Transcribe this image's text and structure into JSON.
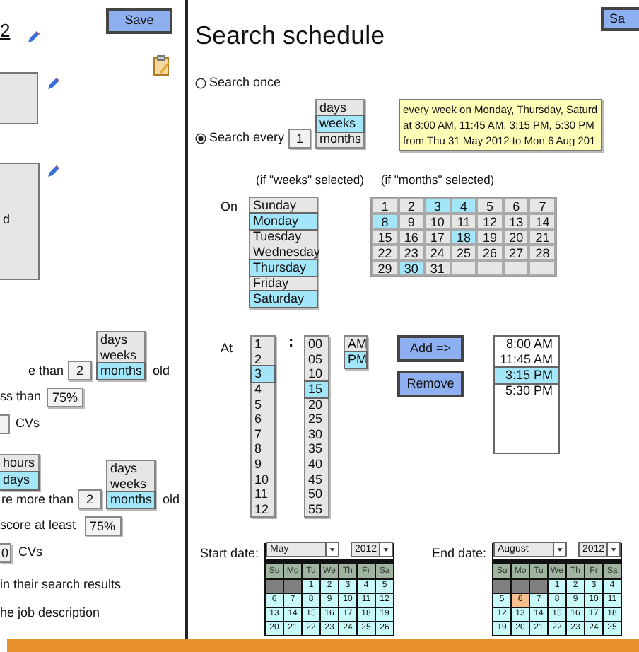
{
  "left_panel": {
    "heading_fragment": "2",
    "save_button": "Save",
    "box_fragment": "d",
    "age_filter_1": {
      "options": [
        {
          "label": "days",
          "selected": false
        },
        {
          "label": "weeks",
          "selected": false
        },
        {
          "label": "months",
          "selected": true
        }
      ],
      "prefix": "e than",
      "value": "2",
      "suffix": "old"
    },
    "score_filter_1": {
      "prefix": "ss than",
      "value": "75%"
    },
    "count_1": {
      "suffix": "CVs"
    },
    "unit_list": [
      {
        "label": "hours",
        "selected": false
      },
      {
        "label": "days",
        "selected": true
      }
    ],
    "age_filter_2": {
      "options": [
        {
          "label": "days",
          "selected": false
        },
        {
          "label": "weeks",
          "selected": false
        },
        {
          "label": "months",
          "selected": true
        }
      ],
      "prefix": "re more than",
      "value": "2",
      "suffix": "old"
    },
    "score_filter_2": {
      "prefix": "score at least",
      "value": "75%"
    },
    "count_2": {
      "value": "0",
      "suffix": "CVs"
    },
    "notes": [
      "in their search results",
      "he job description"
    ]
  },
  "right_panel": {
    "title": "Search schedule",
    "save_button": "Sa",
    "modes": [
      {
        "label": "Search once",
        "selected": false
      },
      {
        "label": "Search every",
        "selected": true
      }
    ],
    "interval": {
      "value": "1",
      "units": [
        {
          "label": "days",
          "selected": false
        },
        {
          "label": "weeks",
          "selected": true
        },
        {
          "label": "months",
          "selected": false
        }
      ]
    },
    "summary": [
      "every week on Monday, Thursday, Saturd",
      "at 8:00 AM, 11:45 AM, 3:15 PM, 5:30 PM",
      "from Thu 31 May 2012 to Mon 6 Aug 201"
    ],
    "weeks_caption": "(if \"weeks\" selected)",
    "months_caption": "(if \"months\" selected)",
    "on_label": "On",
    "weekdays": [
      {
        "label": "Sunday",
        "selected": false
      },
      {
        "label": "Monday",
        "selected": true
      },
      {
        "label": "Tuesday",
        "selected": false
      },
      {
        "label": "Wednesday",
        "selected": false
      },
      {
        "label": "Thursday",
        "selected": true
      },
      {
        "label": "Friday",
        "selected": false
      },
      {
        "label": "Saturday",
        "selected": true
      }
    ],
    "month_days": [
      {
        "label": "1",
        "selected": false
      },
      {
        "label": "2",
        "selected": false
      },
      {
        "label": "3",
        "selected": true
      },
      {
        "label": "4",
        "selected": true
      },
      {
        "label": "5",
        "selected": false
      },
      {
        "label": "6",
        "selected": false
      },
      {
        "label": "7",
        "selected": false
      },
      {
        "label": "8",
        "selected": true
      },
      {
        "label": "9",
        "selected": false
      },
      {
        "label": "10",
        "selected": false
      },
      {
        "label": "11",
        "selected": false
      },
      {
        "label": "12",
        "selected": false
      },
      {
        "label": "13",
        "selected": false
      },
      {
        "label": "14",
        "selected": false
      },
      {
        "label": "15",
        "selected": false
      },
      {
        "label": "16",
        "selected": false
      },
      {
        "label": "17",
        "selected": false
      },
      {
        "label": "18",
        "selected": true
      },
      {
        "label": "19",
        "selected": false
      },
      {
        "label": "20",
        "selected": false
      },
      {
        "label": "21",
        "selected": false
      },
      {
        "label": "22",
        "selected": false
      },
      {
        "label": "23",
        "selected": false
      },
      {
        "label": "24",
        "selected": false
      },
      {
        "label": "25",
        "selected": false
      },
      {
        "label": "26",
        "selected": false
      },
      {
        "label": "27",
        "selected": false
      },
      {
        "label": "28",
        "selected": false
      },
      {
        "label": "29",
        "selected": false
      },
      {
        "label": "30",
        "selected": true
      },
      {
        "label": "31",
        "selected": false
      }
    ],
    "at_label": "At",
    "hours": [
      {
        "label": "1",
        "selected": false
      },
      {
        "label": "2",
        "selected": false
      },
      {
        "label": "3",
        "selected": true
      },
      {
        "label": "4",
        "selected": false
      },
      {
        "label": "5",
        "selected": false
      },
      {
        "label": "6",
        "selected": false
      },
      {
        "label": "7",
        "selected": false
      },
      {
        "label": "8",
        "selected": false
      },
      {
        "label": "9",
        "selected": false
      },
      {
        "label": "10",
        "selected": false
      },
      {
        "label": "11",
        "selected": false
      },
      {
        "label": "12",
        "selected": false
      }
    ],
    "separator": ":",
    "minutes": [
      {
        "label": "00",
        "selected": false
      },
      {
        "label": "05",
        "selected": false
      },
      {
        "label": "10",
        "selected": false
      },
      {
        "label": "15",
        "selected": true
      },
      {
        "label": "20",
        "selected": false
      },
      {
        "label": "25",
        "selected": false
      },
      {
        "label": "30",
        "selected": false
      },
      {
        "label": "35",
        "selected": false
      },
      {
        "label": "40",
        "selected": false
      },
      {
        "label": "45",
        "selected": false
      },
      {
        "label": "50",
        "selected": false
      },
      {
        "label": "55",
        "selected": false
      }
    ],
    "meridiem": [
      {
        "label": "AM",
        "selected": false
      },
      {
        "label": "PM",
        "selected": true
      }
    ],
    "add_button": "Add =>",
    "remove_button": "Remove",
    "times": [
      {
        "label": "8:00 AM",
        "selected": false
      },
      {
        "label": "11:45 AM",
        "selected": false
      },
      {
        "label": "3:15 PM",
        "selected": true
      },
      {
        "label": "5:30 PM",
        "selected": false
      }
    ],
    "dates": [
      {
        "label": "Start date:",
        "month": "May",
        "year": "2012",
        "weekdays": [
          "Su",
          "Mo",
          "Tu",
          "We",
          "Th",
          "Fr",
          "Sa"
        ],
        "days": [
          {
            "kind": "blank"
          },
          {
            "kind": "blank"
          },
          {
            "kind": "day",
            "label": "1",
            "selected": false
          },
          {
            "kind": "day",
            "label": "2",
            "selected": false
          },
          {
            "kind": "day",
            "label": "3",
            "selected": false
          },
          {
            "kind": "day",
            "label": "4",
            "selected": false
          },
          {
            "kind": "day",
            "label": "5",
            "selected": false
          },
          {
            "kind": "day",
            "label": "6",
            "selected": false
          },
          {
            "kind": "day",
            "label": "7",
            "selected": false
          },
          {
            "kind": "day",
            "label": "8",
            "selected": false
          },
          {
            "kind": "day",
            "label": "9",
            "selected": false
          },
          {
            "kind": "day",
            "label": "10",
            "selected": false
          },
          {
            "kind": "day",
            "label": "11",
            "selected": false
          },
          {
            "kind": "day",
            "label": "12",
            "selected": false
          },
          {
            "kind": "day",
            "label": "13",
            "selected": false
          },
          {
            "kind": "day",
            "label": "14",
            "selected": false
          },
          {
            "kind": "day",
            "label": "15",
            "selected": false
          },
          {
            "kind": "day",
            "label": "16",
            "selected": false
          },
          {
            "kind": "day",
            "label": "17",
            "selected": false
          },
          {
            "kind": "day",
            "label": "18",
            "selected": false
          },
          {
            "kind": "day",
            "label": "19",
            "selected": false
          },
          {
            "kind": "day",
            "label": "20",
            "selected": false
          },
          {
            "kind": "day",
            "label": "21",
            "selected": false
          },
          {
            "kind": "day",
            "label": "22",
            "selected": false
          },
          {
            "kind": "day",
            "label": "23",
            "selected": false
          },
          {
            "kind": "day",
            "label": "24",
            "selected": false
          },
          {
            "kind": "day",
            "label": "25",
            "selected": false
          },
          {
            "kind": "day",
            "label": "26",
            "selected": false
          }
        ]
      },
      {
        "label": "End date:",
        "month": "August",
        "year": "2012",
        "weekdays": [
          "Su",
          "Mo",
          "Tu",
          "We",
          "Th",
          "Fr",
          "Sa"
        ],
        "days": [
          {
            "kind": "blank"
          },
          {
            "kind": "blank"
          },
          {
            "kind": "blank"
          },
          {
            "kind": "day",
            "label": "1",
            "selected": false
          },
          {
            "kind": "day",
            "label": "2",
            "selected": false
          },
          {
            "kind": "day",
            "label": "3",
            "selected": false
          },
          {
            "kind": "day",
            "label": "4",
            "selected": false
          },
          {
            "kind": "day",
            "label": "5",
            "selected": false
          },
          {
            "kind": "day",
            "label": "6",
            "selected": true
          },
          {
            "kind": "day",
            "label": "7",
            "selected": false
          },
          {
            "kind": "day",
            "label": "8",
            "selected": false
          },
          {
            "kind": "day",
            "label": "9",
            "selected": false
          },
          {
            "kind": "day",
            "label": "10",
            "selected": false
          },
          {
            "kind": "day",
            "label": "11",
            "selected": false
          },
          {
            "kind": "day",
            "label": "12",
            "selected": false
          },
          {
            "kind": "day",
            "label": "13",
            "selected": false
          },
          {
            "kind": "day",
            "label": "14",
            "selected": false
          },
          {
            "kind": "day",
            "label": "15",
            "selected": false
          },
          {
            "kind": "day",
            "label": "16",
            "selected": false
          },
          {
            "kind": "day",
            "label": "17",
            "selected": false
          },
          {
            "kind": "day",
            "label": "18",
            "selected": false
          },
          {
            "kind": "day",
            "label": "19",
            "selected": false
          },
          {
            "kind": "day",
            "label": "20",
            "selected": false
          },
          {
            "kind": "day",
            "label": "21",
            "selected": false
          },
          {
            "kind": "day",
            "label": "22",
            "selected": false
          },
          {
            "kind": "day",
            "label": "23",
            "selected": false
          },
          {
            "kind": "day",
            "label": "24",
            "selected": false
          },
          {
            "kind": "day",
            "label": "25",
            "selected": false
          }
        ]
      }
    ]
  }
}
